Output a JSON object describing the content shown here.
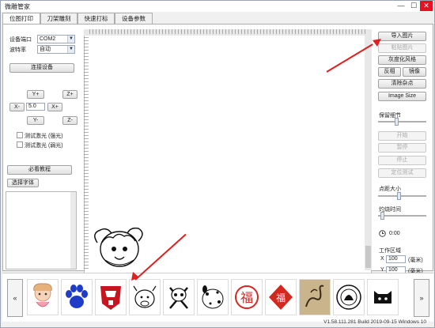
{
  "window": {
    "title": "微雕管家",
    "minimize": "—",
    "maximize": "☐",
    "close": "✕"
  },
  "tabs": [
    {
      "label": "位图打印"
    },
    {
      "label": "刀架雕刻"
    },
    {
      "label": "快速打标"
    },
    {
      "label": "设备参数"
    }
  ],
  "connection": {
    "port_label": "设备端口",
    "port_value": "COM2",
    "baud_label": "波特率",
    "baud_value": "自动",
    "connect_button": "连接设备"
  },
  "jog": {
    "y_plus": "Y+",
    "z_plus": "Z+",
    "x_minus": "X-",
    "step_value": "5.0",
    "x_plus": "X+",
    "y_minus": "Y-",
    "z_minus": "Z-"
  },
  "laser_tests": {
    "strong": "测试激光 (强光)",
    "weak": "测试激光 (弱光)"
  },
  "tutorial_button": "必看教程",
  "font_button": "选择字体",
  "right_panel": {
    "import_image": "导入图片",
    "paste_image": "粘贴图片",
    "grayscale": "灰度化风格",
    "invert": "反相",
    "mirror": "镜像",
    "clear_noise": "清除杂点",
    "image_size": "Image Size",
    "retain_detail": "保留细节",
    "start": "开始",
    "pause": "暂停",
    "stop": "停止",
    "locate_test": "定位测试",
    "dot_size": "点距大小",
    "burn_time": "灼烧时间",
    "timer": "0:00",
    "work_area": "工作区域",
    "x_label": "X",
    "x_value": "100",
    "x_unit": "(毫米)",
    "y_label": "Y",
    "y_value": "100",
    "y_unit": "(毫米)"
  },
  "sliders": {
    "retain_detail": 0.38,
    "dot_size": 0.42,
    "burn_time": 0.05
  },
  "gallery": {
    "prev": "«",
    "next": "»",
    "items": [
      "girl-icon",
      "paw-icon",
      "transformers-icon",
      "cow-icon",
      "skull-icon",
      "dalmatian-icon",
      "fu-seal-icon",
      "fu-diamond-icon",
      "dragon-icon",
      "emblem-icon",
      "cat-icon"
    ]
  },
  "status_text": "V1.58.111.281 Build 2019-09-15 Windows 10",
  "colors": {
    "accent_red": "#e02020",
    "paw_blue": "#1e3cc8",
    "transformers_red": "#c8141e",
    "fu_red": "#d4281e"
  }
}
